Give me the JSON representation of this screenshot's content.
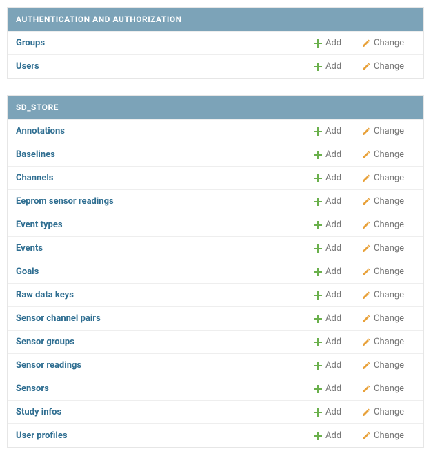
{
  "labels": {
    "add": "Add",
    "change": "Change"
  },
  "colors": {
    "header_bg": "#7ca3b8",
    "link": "#2f6e91",
    "add_icon": "#6ab04c",
    "change_icon": "#e8a13a",
    "action_text": "#777"
  },
  "modules": [
    {
      "title": "AUTHENTICATION AND AUTHORIZATION",
      "models": [
        {
          "name": "Groups"
        },
        {
          "name": "Users"
        }
      ]
    },
    {
      "title": "SD_STORE",
      "models": [
        {
          "name": "Annotations"
        },
        {
          "name": "Baselines"
        },
        {
          "name": "Channels"
        },
        {
          "name": "Eeprom sensor readings"
        },
        {
          "name": "Event types"
        },
        {
          "name": "Events"
        },
        {
          "name": "Goals"
        },
        {
          "name": "Raw data keys"
        },
        {
          "name": "Sensor channel pairs"
        },
        {
          "name": "Sensor groups"
        },
        {
          "name": "Sensor readings"
        },
        {
          "name": "Sensors"
        },
        {
          "name": "Study infos"
        },
        {
          "name": "User profiles"
        }
      ]
    }
  ]
}
